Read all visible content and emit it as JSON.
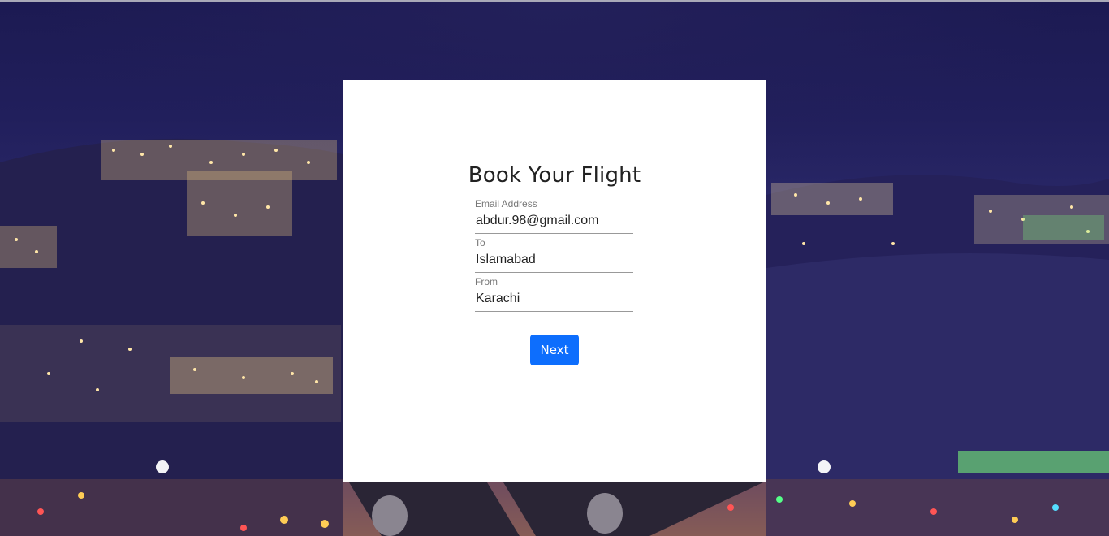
{
  "form": {
    "title": "Book Your Flight",
    "email": {
      "label": "Email Address",
      "value": "abdur.98@gmail.com"
    },
    "to": {
      "label": "To",
      "value": "Islamabad"
    },
    "from": {
      "label": "From",
      "value": "Karachi"
    },
    "next_label": "Next"
  },
  "colors": {
    "button": "#0d6efd",
    "card": "#ffffff",
    "sky": "#1c1a52"
  }
}
